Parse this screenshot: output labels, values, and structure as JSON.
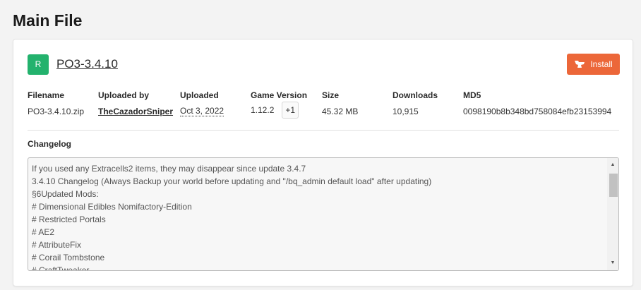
{
  "page": {
    "title": "Main File"
  },
  "file": {
    "badge": "R",
    "name": "PO3-3.4.10",
    "install_label": "Install"
  },
  "meta": {
    "filename_label": "Filename",
    "filename": "PO3-3.4.10.zip",
    "uploader_label": "Uploaded by",
    "uploader": "TheCazadorSniper",
    "uploaded_label": "Uploaded",
    "uploaded": "Oct 3, 2022",
    "game_version_label": "Game Version",
    "game_version": "1.12.2",
    "game_version_extra": "+1",
    "size_label": "Size",
    "size": "45.32 MB",
    "downloads_label": "Downloads",
    "downloads": "10,915",
    "md5_label": "MD5",
    "md5": "0098190b8b348bd758084efb23153994"
  },
  "changelog": {
    "label": "Changelog",
    "lines": [
      "If you used any Extracells2 items, they may disappear since update 3.4.7",
      "3.4.10 Changelog (Always Backup your world before updating and \"/bq_admin default load\" after updating)",
      "§6Updated Mods:",
      "# Dimensional Edibles Nomifactory-Edition",
      "# Restricted Portals",
      "# AE2",
      "# AttributeFix",
      "# Corail Tombstone",
      "# CraftTweaker"
    ]
  },
  "colors": {
    "badge": "#23b26d",
    "install": "#ec6739"
  }
}
